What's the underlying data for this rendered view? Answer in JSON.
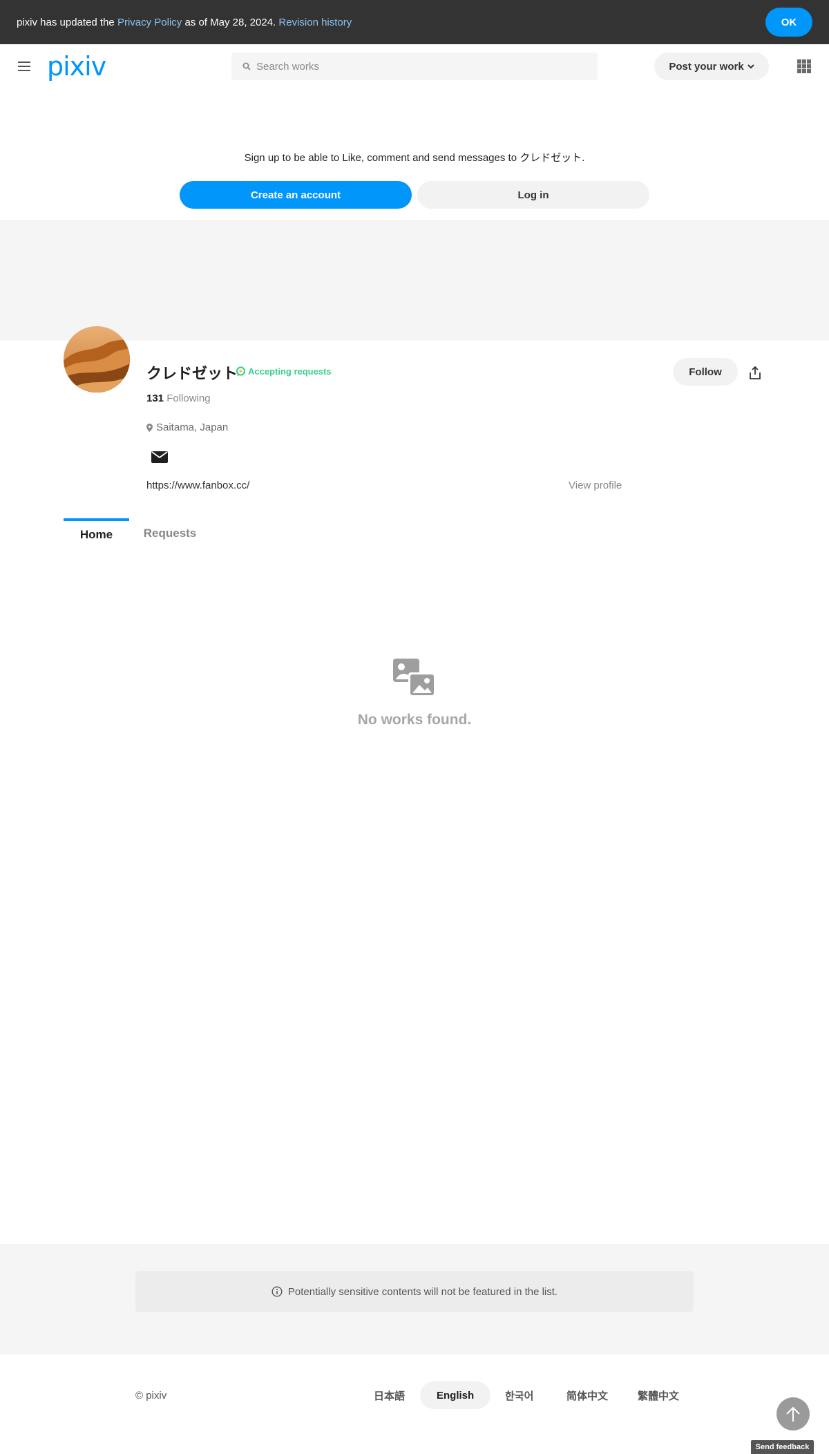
{
  "banner": {
    "prefix": "pixiv has updated the ",
    "privacy_link": "Privacy Policy",
    "middle": " as of May 28, 2024. ",
    "revision_link": "Revision history",
    "ok_label": "OK"
  },
  "header": {
    "logo": "pixiv",
    "search_placeholder": "Search works",
    "post_label": "Post your work"
  },
  "signup": {
    "message": "Sign up to be able to Like, comment and send messages to クレドゼット.",
    "create_label": "Create an account",
    "login_label": "Log in"
  },
  "profile": {
    "name": "クレドゼット",
    "badge": "Accepting requests",
    "following_count": "131",
    "following_label": "Following",
    "location": "Saitama, Japan",
    "url": "https://www.fanbox.cc/",
    "view_profile": "View profile",
    "follow_label": "Follow"
  },
  "tabs": {
    "home": "Home",
    "requests": "Requests"
  },
  "empty": {
    "message": "No works found."
  },
  "notice": {
    "text": "Potentially sensitive contents will not be featured in the list."
  },
  "footer": {
    "copyright": "© pixiv",
    "languages": [
      "日本語",
      "English",
      "한국어",
      "简体中文",
      "繁體中文"
    ],
    "active_language": "English",
    "feedback": "Send feedback"
  },
  "colors": {
    "accent": "#0096fa",
    "badge": "#3ccf8e",
    "banner_bg": "#333333"
  }
}
